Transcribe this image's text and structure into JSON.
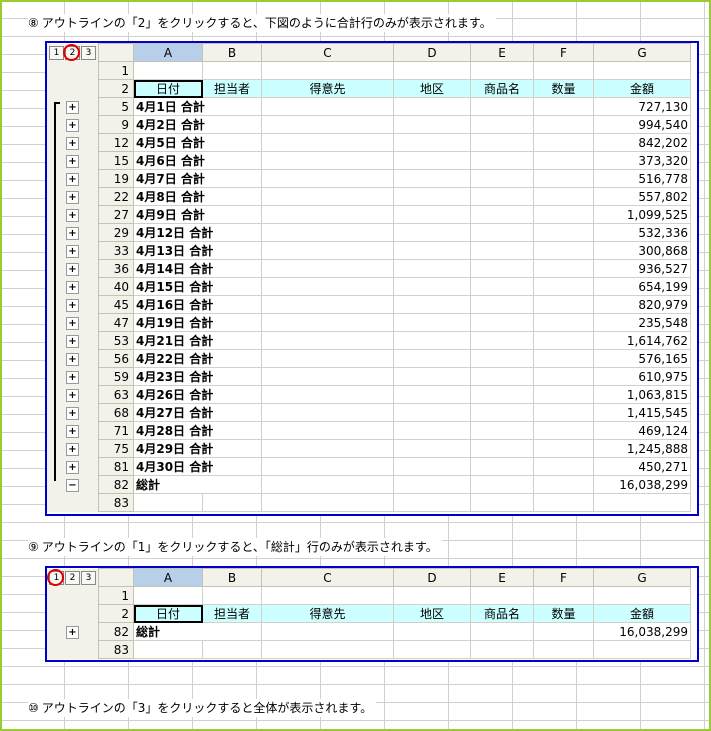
{
  "captions": {
    "c8": {
      "num": "⑧",
      "text": "アウトラインの「2」をクリックすると、下図のように合計行のみが表示されます。"
    },
    "c9": {
      "num": "⑨",
      "text": "アウトラインの「1」をクリックすると、「総計」行のみが表示されます。"
    },
    "c10": {
      "num": "⑩",
      "text": "アウトラインの「3」をクリックすると全体が表示されます。"
    }
  },
  "outline_levels": [
    "1",
    "2",
    "3"
  ],
  "columns": [
    "A",
    "B",
    "C",
    "D",
    "E",
    "F",
    "G"
  ],
  "header_row": {
    "num": "2",
    "cells": [
      "日付",
      "担当者",
      "得意先",
      "地区",
      "商品名",
      "数量",
      "金額"
    ]
  },
  "sheet1": {
    "row1": "1",
    "rows": [
      {
        "num": "5",
        "label": "4月1日 合計",
        "amount": "727,130"
      },
      {
        "num": "9",
        "label": "4月2日 合計",
        "amount": "994,540"
      },
      {
        "num": "12",
        "label": "4月5日 合計",
        "amount": "842,202"
      },
      {
        "num": "15",
        "label": "4月6日 合計",
        "amount": "373,320"
      },
      {
        "num": "19",
        "label": "4月7日 合計",
        "amount": "516,778"
      },
      {
        "num": "22",
        "label": "4月8日 合計",
        "amount": "557,802"
      },
      {
        "num": "27",
        "label": "4月9日 合計",
        "amount": "1,099,525"
      },
      {
        "num": "29",
        "label": "4月12日 合計",
        "amount": "532,336"
      },
      {
        "num": "33",
        "label": "4月13日 合計",
        "amount": "300,868"
      },
      {
        "num": "36",
        "label": "4月14日 合計",
        "amount": "936,527"
      },
      {
        "num": "40",
        "label": "4月15日 合計",
        "amount": "654,199"
      },
      {
        "num": "45",
        "label": "4月16日 合計",
        "amount": "820,979"
      },
      {
        "num": "47",
        "label": "4月19日 合計",
        "amount": "235,548"
      },
      {
        "num": "53",
        "label": "4月21日 合計",
        "amount": "1,614,762"
      },
      {
        "num": "56",
        "label": "4月22日 合計",
        "amount": "576,165"
      },
      {
        "num": "59",
        "label": "4月23日 合計",
        "amount": "610,975"
      },
      {
        "num": "63",
        "label": "4月26日 合計",
        "amount": "1,063,815"
      },
      {
        "num": "68",
        "label": "4月27日 合計",
        "amount": "1,415,545"
      },
      {
        "num": "71",
        "label": "4月28日 合計",
        "amount": "469,124"
      },
      {
        "num": "75",
        "label": "4月29日 合計",
        "amount": "1,245,888"
      },
      {
        "num": "81",
        "label": "4月30日 合計",
        "amount": "450,271"
      }
    ],
    "total": {
      "num": "82",
      "label": "総計",
      "amount": "16,038,299"
    },
    "last": "83"
  },
  "sheet2": {
    "row1": "1",
    "total": {
      "num": "82",
      "label": "総計",
      "amount": "16,038,299"
    },
    "last": "83"
  },
  "symbols": {
    "expand": "+",
    "collapse": "−"
  }
}
